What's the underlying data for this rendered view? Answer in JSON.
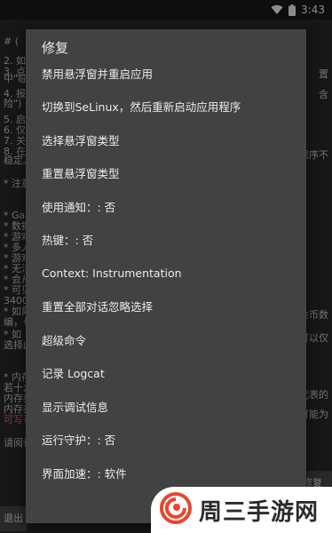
{
  "status_bar": {
    "time": "3:43"
  },
  "background_content": {
    "lines_left": [
      "# (",
      "2. 如",
      "3. 点",
      "中\"临",
      "4. 报",
      "险\") ,",
      "5. 启",
      "6. 仅",
      "7. 关",
      "8. 在",
      "稳定。",
      "* 注意",
      "* Gam",
      "* 数据",
      "* 游戏",
      "* 多人",
      "* 游戏",
      "* 无法",
      "* 会从",
      "* 可见",
      "34000",
      "* 如果",
      "编，也",
      "* 如",
      "选择此",
      "* 内存",
      "若十六",
      "内存类",
      "内存类",
      "可写可",
      "请阅读"
    ],
    "lines_right": [
      "置",
      "含",
      "程序不",
      "金币数",
      "可以仅",
      "代表的",
      "可能为"
    ],
    "buttons": {
      "right": "修复",
      "bottom_left": "退出"
    }
  },
  "menu": {
    "title": "修复",
    "items": [
      "禁用悬浮窗并重启应用",
      "切换到SeLinux，然后重新启动应用程序",
      "选择悬浮窗类型",
      "重置悬浮窗类型",
      "使用通知：: 否",
      "热键：: 否",
      "Context: Instrumentation",
      "重置全部对话忽略选择",
      "超级命令",
      "记录 Logcat",
      "显示调试信息",
      "运行守护：: 否",
      "界面加速：: 软件"
    ]
  },
  "watermark": {
    "text": "周三手游网"
  },
  "colors": {
    "menu_bg": "#424242",
    "accent_logo": "#e8452f",
    "pink_text": "#e06a9c"
  },
  "icons": [
    "wifi-icon",
    "battery-icon",
    "logo-swirl-icon"
  ]
}
